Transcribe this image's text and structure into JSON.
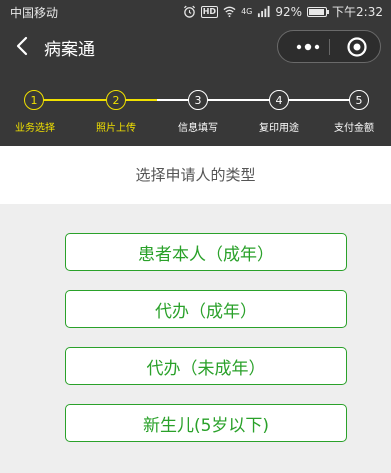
{
  "status_bar": {
    "carrier": "中国移动",
    "hd": "HD",
    "network": "4G",
    "battery_percent_text": "92%",
    "battery_level": 0.92,
    "time": "下午2:32"
  },
  "nav": {
    "title": "病案通",
    "back_icon": "chevron-left-icon",
    "more_icon": "more-dots-icon",
    "close_icon": "target-circle-icon"
  },
  "steps": {
    "active_color": "#f0e000",
    "inactive_color": "#ffffff",
    "items": [
      {
        "number": "1",
        "label": "业务选择",
        "active": true
      },
      {
        "number": "2",
        "label": "照片上传",
        "active": true
      },
      {
        "number": "3",
        "label": "信息填写",
        "active": false
      },
      {
        "number": "4",
        "label": "复印用途",
        "active": false
      },
      {
        "number": "5",
        "label": "支付金额",
        "active": false
      }
    ]
  },
  "prompt": "选择申请人的类型",
  "options": [
    {
      "label": "患者本人（成年）"
    },
    {
      "label": "代办（成年）"
    },
    {
      "label": "代办（未成年）"
    },
    {
      "label": "新生儿(5岁以下)"
    }
  ],
  "colors": {
    "accent": "#2aa12a",
    "bar_bg": "#383838",
    "page_bg": "#eeeeee"
  }
}
